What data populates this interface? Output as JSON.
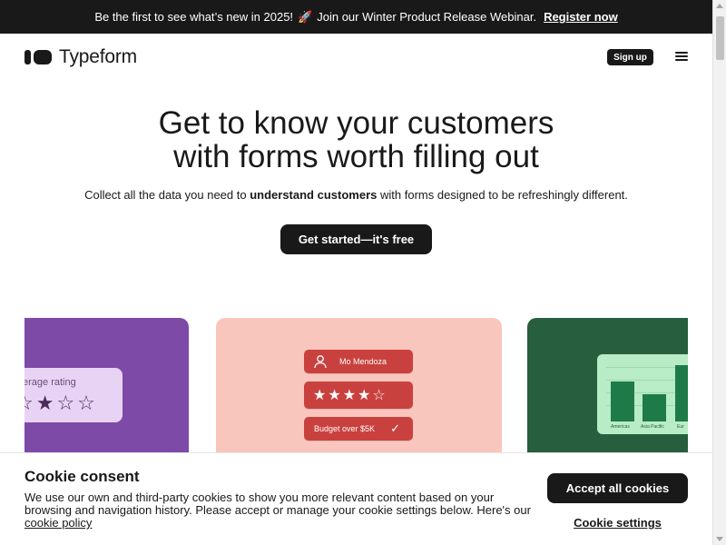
{
  "banner": {
    "text": "Be the first to see what’s new in 2025!",
    "rocket": "🚀",
    "text2": "Join our Winter Product Release Webinar.",
    "link": "Register now"
  },
  "nav": {
    "brand": "Typeform",
    "signup": "Sign up",
    "menu_icon": "hamburger-menu-icon"
  },
  "hero": {
    "title_line1": "Get to know your customers",
    "title_line2": "with forms worth filling out",
    "subtitle_pre": "Collect all the data you need to",
    "subtitle_bold": "understand customers",
    "subtitle_post": "with forms designed to be refreshingly different.",
    "cta": "Get started—it's free"
  },
  "cards": {
    "purple": {
      "label": "erage rating",
      "stars": "★☆☆",
      "color": "#7d4aa8"
    },
    "pink": {
      "person_name": "Mo Mendoza",
      "stars": "★★★★☆",
      "budget": "Budget over $5K",
      "check": "✓",
      "color": "#f9c6bd"
    },
    "green": {
      "labels": [
        "Americas",
        "Asia Pacific",
        "Eur"
      ],
      "color": "#275e3e"
    }
  },
  "cookie": {
    "title": "Cookie consent",
    "text": "We use our own and third-party cookies to show you more relevant content based on your browsing and navigation history. Please accept or manage your cookie settings below. Here's our",
    "link": "cookie policy",
    "accept": "Accept all cookies",
    "settings": "Cookie settings"
  }
}
